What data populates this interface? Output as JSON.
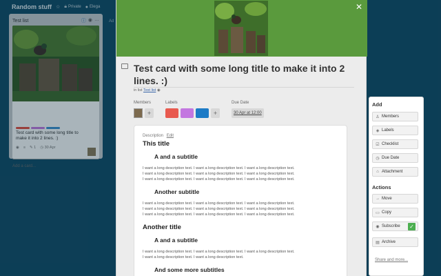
{
  "board": {
    "title": "Random stuff",
    "privacy": "Private",
    "team": "Elega",
    "add_list_hint": "Ad"
  },
  "list": {
    "title": "Test list",
    "add_card": "Add a card...",
    "card": {
      "title": "Test card with some long title to make it into 2 lines. :)",
      "comments": "1",
      "due": "30 Apr",
      "labels": [
        "#e74c3c",
        "#c377e0",
        "#3a8fd1"
      ]
    }
  },
  "card_detail": {
    "title": "Test card with some long title to make it into 2 lines. :)",
    "in_list_prefix": "in list",
    "list_name": "Test list",
    "members_header": "Members",
    "labels_header": "Labels",
    "due_header": "Due Date",
    "due_value": "30 Apr at 12:00",
    "label_colors": [
      "#e85a4f",
      "#c377e0",
      "#1d7bc6"
    ],
    "description": {
      "label": "Description",
      "edit": "Edit",
      "h1_title": "This title",
      "subtitle_1": "A and a subtitle",
      "para_1": [
        "I want a long description text. I want a long description text. I want a long description text.",
        "I want a long description text. I want a long description text. I want a long description text.",
        "I want a long description text. I want a long description text. I want a long description text."
      ],
      "subtitle_2": "Another subtitle",
      "para_2": [
        "I want a long description text. I want a long description text. I want a long description text.",
        "I want a long description text. I want a long description text. I want a long description text.",
        "I want a long description text. I want a long description text. I want a long description text."
      ],
      "h1_another": "Another title",
      "subtitle_3": "A and a subtitle",
      "para_3": [
        "I want a long description text. I want a long description text. I want a long description text.",
        "I want a long description text. I want a long description text."
      ],
      "subtitle_4": "And some more subtitles"
    }
  },
  "sidebar": {
    "add_header": "Add",
    "add_items": [
      "Members",
      "Labels",
      "Checklist",
      "Due Date",
      "Attachment"
    ],
    "actions_header": "Actions",
    "action_items": [
      "Move",
      "Copy",
      "Subscribe",
      "Archive"
    ],
    "share": "Share and more..."
  },
  "colors": {
    "board_bg": "#0e4a66",
    "cover_bg": "#5a9a3d",
    "link": "#3a66a8"
  }
}
